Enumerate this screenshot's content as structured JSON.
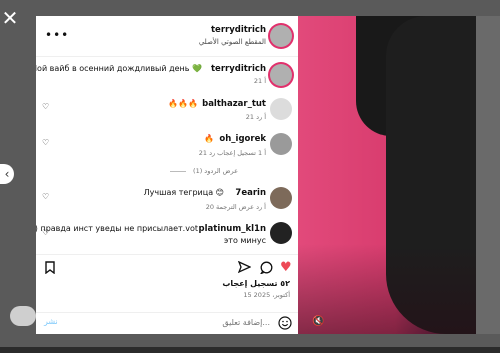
{
  "post": {
    "author": "terryditrich",
    "audio": "المقطع الصوتي الأصلي",
    "likes": "٥٢ تسجيل إعجاب",
    "date": "15 أكتوبر، 2025"
  },
  "comments": [
    {
      "user": "terryditrich",
      "text": "Мой вайб в осенний дождливый день 💚",
      "meta": "21 أ"
    },
    {
      "user": "balthazar_tut",
      "text": "🔥🔥🔥",
      "meta": "21 أ   رد"
    },
    {
      "user": "oh_igorek",
      "text": "🔥",
      "meta": "21 أ   1 تسجيل إعجاب   رد",
      "replies": "عرض الردود (1)"
    },
    {
      "user": "7earin",
      "text": "Лучшая тегрица 😊",
      "meta": "20 أ   رد   عرض الترجمة"
    },
    {
      "user": "platinum_kl1n",
      "text": "Имба) правда инст уведы не присылает.vot",
      "text2": "это минус"
    }
  ],
  "composer": {
    "placeholder": "إضافة تعليق...",
    "post_label": "نشر"
  },
  "icons": {
    "close": "close-icon",
    "prev": "chevron-left-icon",
    "options": "more-icon",
    "bookmark": "bookmark-icon",
    "share": "share-icon",
    "comment": "comment-icon",
    "like": "heart-icon",
    "emoji": "emoji-icon",
    "mute": "mute-icon"
  },
  "colors": {
    "like_red": "#ed4956",
    "ring": "#e1306c",
    "post_blue": "#0095f6"
  }
}
